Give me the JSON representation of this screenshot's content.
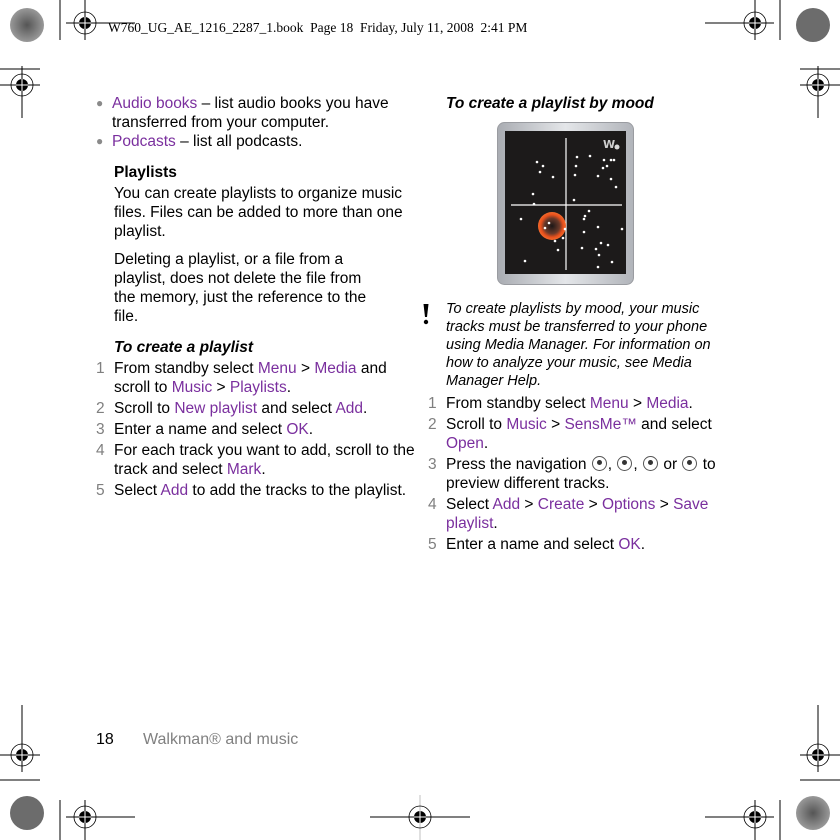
{
  "header": {
    "print_info": "W760_UG_AE_1216_2287_1.book  Page 18  Friday, July 11, 2008  2:41 PM"
  },
  "left_column": {
    "bullets": [
      {
        "link": "Audio books",
        "text": " – list audio books you have transferred from your computer."
      },
      {
        "link": "Podcasts",
        "text": " – list all podcasts."
      }
    ],
    "playlists_heading": "Playlists",
    "playlists_body": "You can create playlists to organize music files. Files can be added to more than one playlist.",
    "delete_note": "Deleting a playlist, or a file from a playlist, does not delete the file from the memory, just the reference to the file.",
    "procedure_title": "To create a playlist",
    "steps": [
      {
        "n": "1",
        "parts": [
          [
            "From standby select ",
            false
          ],
          [
            "Menu",
            true
          ],
          [
            " > ",
            false
          ],
          [
            "Media",
            true
          ],
          [
            " and scroll to ",
            false
          ],
          [
            "Music",
            true
          ],
          [
            " > ",
            false
          ],
          [
            "Playlists",
            true
          ],
          [
            ".",
            false
          ]
        ]
      },
      {
        "n": "2",
        "parts": [
          [
            "Scroll to ",
            false
          ],
          [
            "New playlist",
            true
          ],
          [
            " and select ",
            false
          ],
          [
            "Add",
            true
          ],
          [
            ".",
            false
          ]
        ]
      },
      {
        "n": "3",
        "parts": [
          [
            "Enter a name and select ",
            false
          ],
          [
            "OK",
            true
          ],
          [
            ".",
            false
          ]
        ]
      },
      {
        "n": "4",
        "parts": [
          [
            "For each track you want to add, scroll to the track and select ",
            false
          ],
          [
            "Mark",
            true
          ],
          [
            ".",
            false
          ]
        ]
      },
      {
        "n": "5",
        "parts": [
          [
            "Select ",
            false
          ],
          [
            "Add",
            true
          ],
          [
            " to add the tracks to the playlist.",
            false
          ]
        ]
      }
    ]
  },
  "right_column": {
    "procedure_title": "To create a playlist by mood",
    "figure": {
      "name": "SensMe mood map screen",
      "logo": "walkman-logo"
    },
    "note": "To create playlists by mood, your music tracks must be transferred to your phone using Media Manager. For information on how to analyze your music, see Media Manager Help.",
    "steps": [
      {
        "n": "1",
        "parts": [
          [
            "From standby select ",
            false
          ],
          [
            "Menu",
            true
          ],
          [
            " > ",
            false
          ],
          [
            "Media",
            true
          ],
          [
            ".",
            false
          ]
        ]
      },
      {
        "n": "2",
        "parts": [
          [
            "Scroll to ",
            false
          ],
          [
            "Music",
            true
          ],
          [
            " > ",
            false
          ],
          [
            "SensMe™",
            true
          ],
          [
            " and select ",
            false
          ],
          [
            "Open",
            true
          ],
          [
            ".",
            false
          ]
        ]
      },
      {
        "n": "3",
        "parts": [
          [
            "Press the navigation ",
            false
          ],
          [
            "{nav-up}",
            "icon"
          ],
          [
            ", ",
            false
          ],
          [
            "{nav-down}",
            "icon"
          ],
          [
            ", ",
            false
          ],
          [
            "{nav-left}",
            "icon"
          ],
          [
            " or ",
            false
          ],
          [
            "{nav-right}",
            "icon"
          ],
          [
            " to preview different tracks.",
            false
          ]
        ]
      },
      {
        "n": "4",
        "parts": [
          [
            "Select ",
            false
          ],
          [
            "Add",
            true
          ],
          [
            " > ",
            false
          ],
          [
            "Create",
            true
          ],
          [
            " > ",
            false
          ],
          [
            "Options",
            true
          ],
          [
            " > ",
            false
          ],
          [
            "Save playlist",
            true
          ],
          [
            ".",
            false
          ]
        ]
      },
      {
        "n": "5",
        "parts": [
          [
            "Enter a name and select ",
            false
          ],
          [
            "OK",
            true
          ],
          [
            ".",
            false
          ]
        ]
      }
    ]
  },
  "footer": {
    "page_number": "18",
    "section_title": "Walkman® and music"
  },
  "colors": {
    "link": "#7a2f9e",
    "step_number": "#7f7f7f",
    "footer_title": "#808080",
    "screen_bg": "#1c1a1a",
    "mood_highlight": "#e8501c"
  }
}
